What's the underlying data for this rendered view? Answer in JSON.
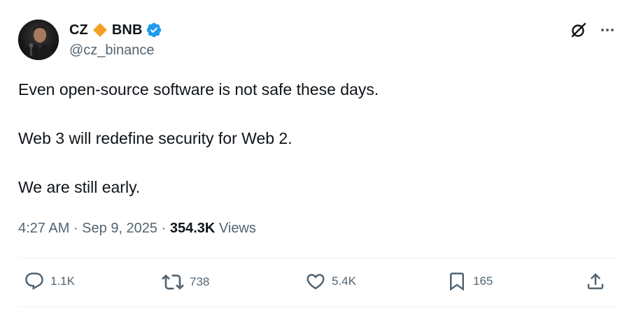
{
  "author": {
    "display_name": "CZ",
    "badge_text": "BNB",
    "handle": "@cz_binance",
    "verified_color": "#1d9bf0",
    "diamond_color": "#f3a124"
  },
  "tweet": {
    "paragraphs": [
      "Even open-source software is not safe these days.",
      "Web 3 will redefine security for Web 2.",
      "We are still early."
    ],
    "time": "4:27 AM",
    "separator": " · ",
    "date": "Sep 9, 2025",
    "views_count": "354.3K",
    "views_label": "Views"
  },
  "actions": {
    "replies": "1.1K",
    "reposts": "738",
    "likes": "5.4K",
    "bookmarks": "165"
  },
  "icons": {
    "grok": "grok-icon",
    "more": "more-icon",
    "reply": "reply-icon",
    "repost": "repost-icon",
    "like": "like-icon",
    "bookmark": "bookmark-icon",
    "share": "share-icon"
  }
}
